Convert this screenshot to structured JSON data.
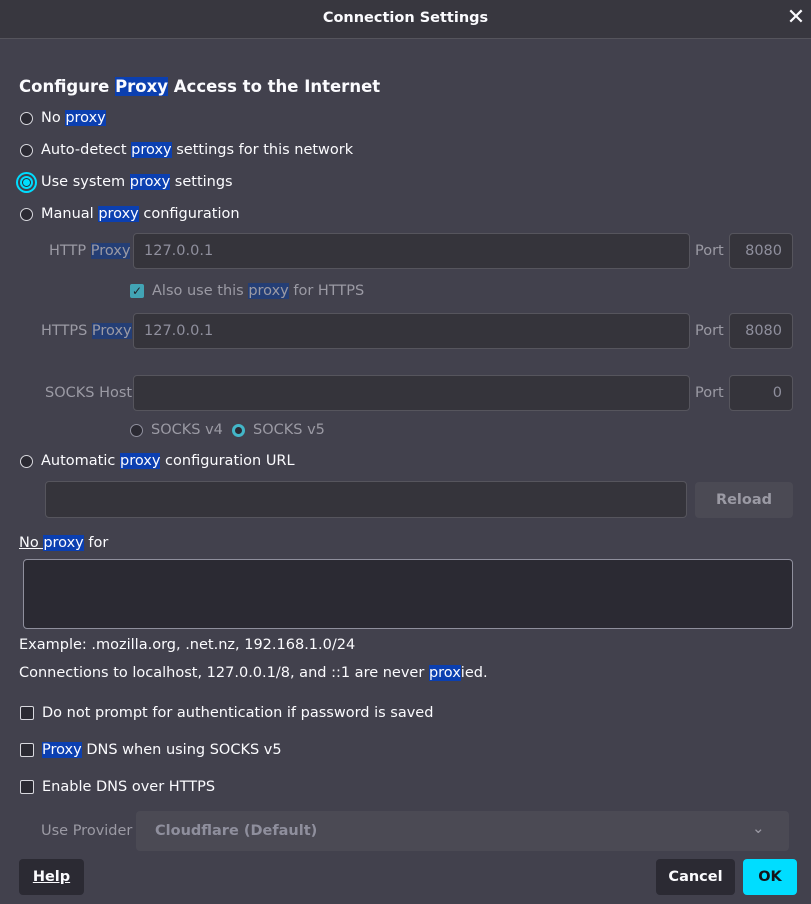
{
  "window": {
    "title": "Connection Settings"
  },
  "heading": {
    "pre": "Configure ",
    "hl": "Proxy",
    "post": " Access to the Internet"
  },
  "options": {
    "no_proxy": {
      "pre": "No ",
      "hl": "proxy",
      "post": ""
    },
    "auto_detect": {
      "pre": "Auto-detect ",
      "hl": "proxy",
      "post": " settings for this network"
    },
    "system": {
      "pre": "Use system ",
      "hl": "proxy",
      "post": " settings"
    },
    "manual": {
      "pre": "Manual ",
      "hl": "proxy",
      "post": " configuration"
    },
    "auto_url": {
      "pre": "Automatic ",
      "hl": "proxy",
      "post": " configuration URL"
    }
  },
  "selected_option": "system",
  "http": {
    "label_pre": "HTTP ",
    "label_hl": "Proxy",
    "value": "127.0.0.1",
    "port_label": "Port",
    "port": "8080"
  },
  "also_https": {
    "pre": "Also use this ",
    "hl": "proxy",
    "post": " for HTTPS",
    "checked": true
  },
  "https": {
    "label_pre": "HTTPS ",
    "label_hl": "Proxy",
    "value": "127.0.0.1",
    "port_label": "Port",
    "port": "8080"
  },
  "socks": {
    "label": "SOCKS Host",
    "value": "",
    "port_label": "Port",
    "port": "0",
    "v4": "SOCKS v4",
    "v5": "SOCKS v5",
    "selected": "v5"
  },
  "auto_url": {
    "value": "",
    "reload": "Reload"
  },
  "no_proxy_for": {
    "pre": "No ",
    "hl": "proxy",
    "post": " for",
    "value": ""
  },
  "example": "Example: .mozilla.org, .net.nz, 192.168.1.0/24",
  "localhost_note": {
    "pre": "Connections to localhost, 127.0.0.1/8, and ::1 are never ",
    "hl": "prox",
    "post": "ied."
  },
  "checks": {
    "no_prompt": {
      "label": "Do not prompt for authentication if password is saved",
      "checked": false
    },
    "proxy_dns": {
      "hl": "Proxy",
      "post": " DNS when using SOCKS v5",
      "checked": false
    },
    "doh": {
      "label": "Enable DNS over HTTPS",
      "checked": false
    }
  },
  "provider": {
    "label": "Use Provider",
    "value": "Cloudflare (Default)"
  },
  "buttons": {
    "help": "Help",
    "cancel": "Cancel",
    "ok": "OK"
  },
  "colors": {
    "background": "#42414d",
    "accent": "#00ddff",
    "highlight": "#0b3fb0"
  }
}
